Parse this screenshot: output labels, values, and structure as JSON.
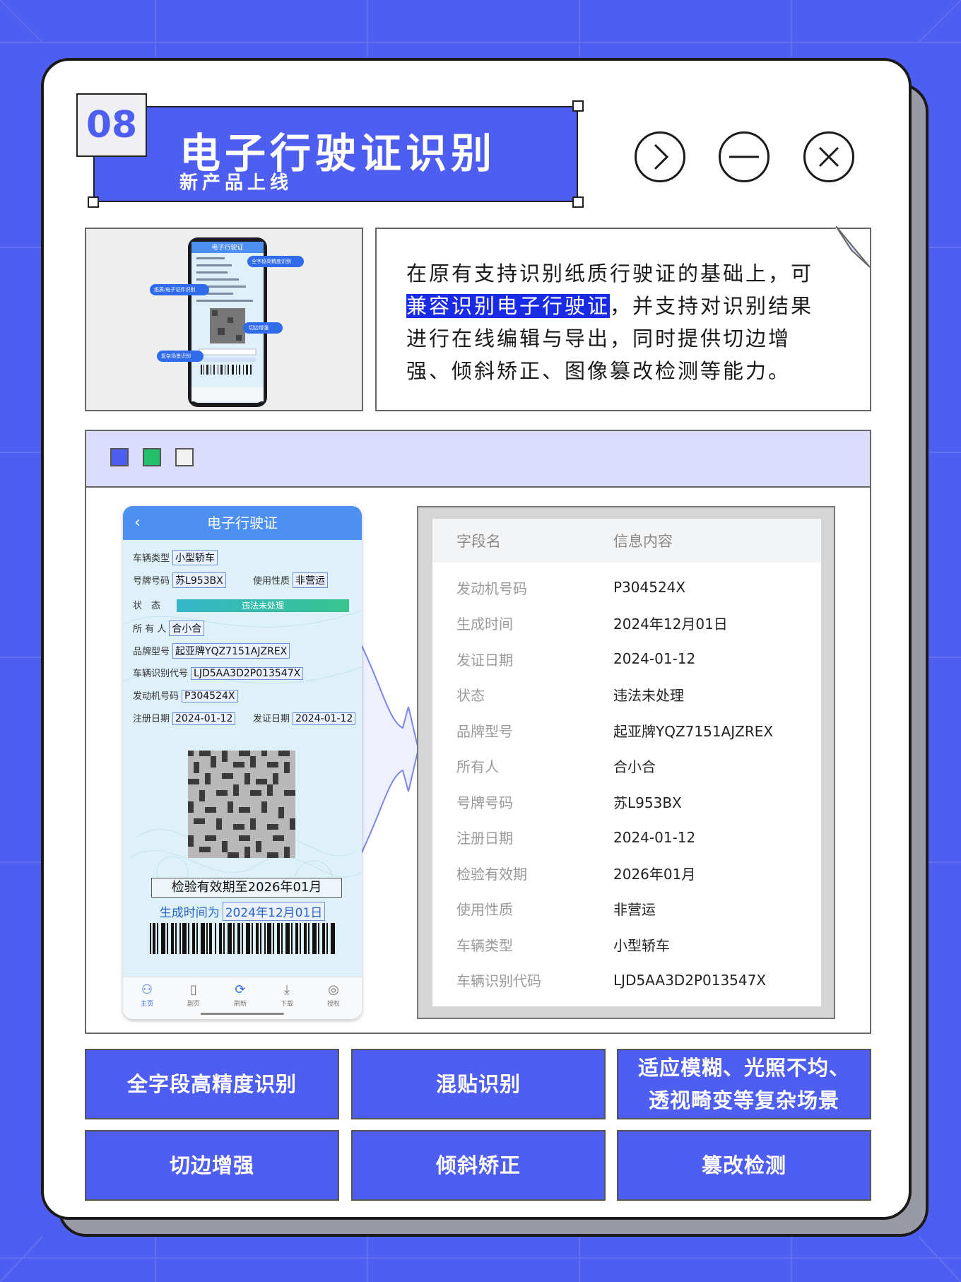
{
  "header": {
    "number": "08",
    "title": "电子行驶证识别",
    "subtitle": "新产品上线"
  },
  "window_controls": [
    "next-icon",
    "minimize-icon",
    "close-icon"
  ],
  "description": {
    "before": "在原有支持识别纸质行驶证的基础上，可",
    "highlight": "兼容识别电子行驶证",
    "after": "，并支持对识别结果进行在线编辑与导出，同时提供切边增强、倾斜矫正、图像篡改检测等能力。"
  },
  "phone_panel": {
    "screen_title": "电子行驶证",
    "tags": [
      "全字段高精度识别",
      "纸质/电子证件识别",
      "切边增强",
      "复杂场景识别"
    ]
  },
  "demo": {
    "phone": {
      "title": "电子行驶证",
      "labels": {
        "vehicle_type": "车辆类型",
        "plate": "号牌号码",
        "usage": "使用性质",
        "status": "状　态",
        "owner": "所 有 人",
        "brand": "品牌型号",
        "vin": "车辆识别代号",
        "engine": "发动机号码",
        "reg_date": "注册日期",
        "issue_date": "发证日期"
      },
      "values": {
        "vehicle_type": "小型轿车",
        "plate": "苏L953BX",
        "usage": "非营运",
        "status": "违法未处理",
        "owner": "合小合",
        "brand": "起亚牌YQZ7151AJZREX",
        "vin": "LJD5AA3D2P013547X",
        "engine": "P304524X",
        "reg_date": "2024-01-12",
        "issue_date": "2024-01-12"
      },
      "valid_text": "检验有效期至2026年01月",
      "gen_prefix": "生成时间为",
      "gen_date": "2024年12月01日",
      "tabs": [
        "主页",
        "副页",
        "刷新",
        "下载",
        "授权"
      ]
    },
    "table": {
      "headers": [
        "字段名",
        "信息内容"
      ],
      "rows": [
        [
          "发动机号码",
          "P304524X"
        ],
        [
          "生成时间",
          "2024年12月01日"
        ],
        [
          "发证日期",
          "2024-01-12"
        ],
        [
          "状态",
          "违法未处理"
        ],
        [
          "品牌型号",
          "起亚牌YQZ7151AJZREX"
        ],
        [
          "所有人",
          "合小合"
        ],
        [
          "号牌号码",
          "苏L953BX"
        ],
        [
          "注册日期",
          "2024-01-12"
        ],
        [
          "检验有效期",
          "2026年01月"
        ],
        [
          "使用性质",
          "非营运"
        ],
        [
          "车辆类型",
          "小型轿车"
        ],
        [
          "车辆识别代码",
          "LJD5AA3D2P013547X"
        ]
      ]
    }
  },
  "features": [
    "全字段高精度识别",
    "混贴识别",
    "适应模糊、光照不均、透视畸变等复杂场景",
    "切边增强",
    "倾斜矫正",
    "篡改检测"
  ],
  "colors": {
    "accent": "#4e5ef0",
    "highlight": "#1a2be6",
    "window_bar": "#dcdcfc",
    "square_1": "#4e5ef0",
    "square_2": "#22c06a",
    "square_3": "#f2f2f2"
  }
}
